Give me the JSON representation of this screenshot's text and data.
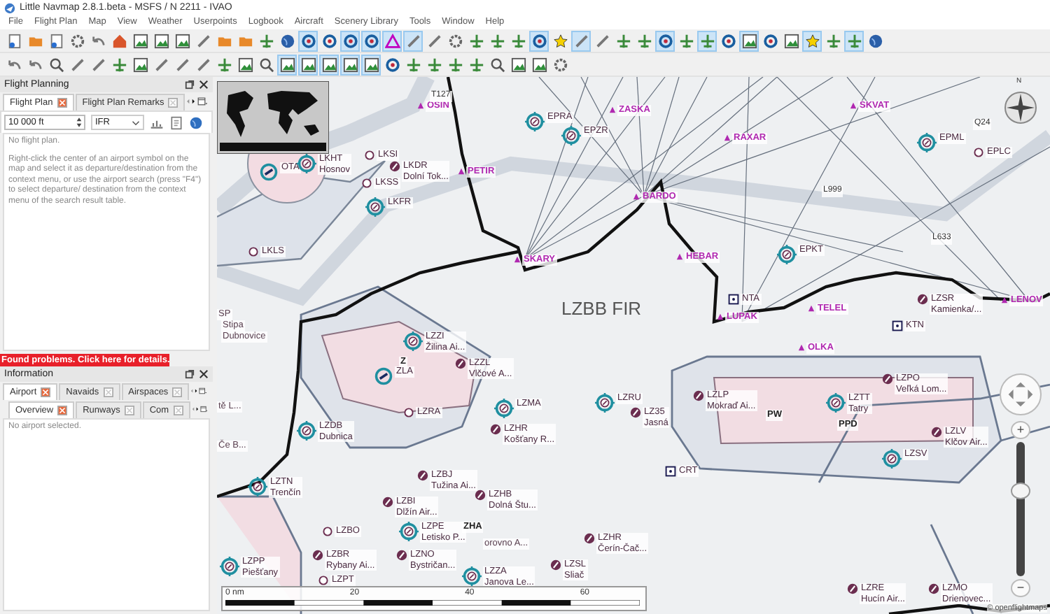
{
  "window": {
    "title": "Little Navmap 2.8.1.beta - MSFS / N 2211 - IVAO"
  },
  "menu": [
    "File",
    "Flight Plan",
    "Map",
    "View",
    "Weather",
    "Userpoints",
    "Logbook",
    "Aircraft",
    "Scenery Library",
    "Tools",
    "Window",
    "Help"
  ],
  "toolbar": {
    "rows": [
      [
        {
          "on": false
        },
        {
          "on": false
        },
        {
          "on": false
        },
        {
          "on": false
        },
        {
          "on": false
        },
        {
          "on": false
        },
        {
          "on": false
        },
        {
          "on": false
        },
        {
          "on": false
        },
        {
          "on": false
        },
        {
          "on": false
        },
        {
          "on": false
        },
        {
          "on": false
        },
        {
          "on": false
        },
        {
          "on": true
        },
        {
          "on": false
        },
        {
          "on": true
        },
        {
          "on": true
        },
        {
          "on": true
        },
        {
          "on": true
        },
        {
          "on": false
        },
        {
          "on": false
        },
        {
          "on": false
        },
        {
          "on": false
        },
        {
          "on": false
        },
        {
          "on": true
        },
        {
          "on": false
        },
        {
          "on": true
        },
        {
          "on": false
        },
        {
          "on": false
        },
        {
          "on": false
        },
        {
          "on": true
        },
        {
          "on": false
        },
        {
          "on": true
        },
        {
          "on": false
        },
        {
          "on": true
        },
        {
          "on": false
        },
        {
          "on": false
        },
        {
          "on": true
        },
        {
          "on": false
        },
        {
          "on": true
        },
        {
          "on": false
        }
      ],
      [
        {
          "on": false
        },
        {
          "on": false
        },
        {
          "on": false
        },
        {
          "on": false
        },
        {
          "on": false
        },
        {
          "on": false
        },
        {
          "on": false
        },
        {
          "on": false
        },
        {
          "on": false
        },
        {
          "on": false
        },
        {
          "on": false
        },
        {
          "on": false
        },
        {
          "on": false
        },
        {
          "on": true
        },
        {
          "on": true
        },
        {
          "on": true
        },
        {
          "on": true
        },
        {
          "on": true
        },
        {
          "on": false
        },
        {
          "on": false
        },
        {
          "on": false
        },
        {
          "on": false
        },
        {
          "on": false
        },
        {
          "on": false
        },
        {
          "on": false
        },
        {
          "on": false
        },
        {
          "on": false
        }
      ]
    ]
  },
  "flight_planning": {
    "title": "Flight Planning",
    "tabs": [
      {
        "label": "Flight Plan",
        "selected": true
      },
      {
        "label": "Flight Plan Remarks",
        "selected": false
      }
    ],
    "altitude": {
      "value": "10 000 ft"
    },
    "flight_rules": {
      "value": "IFR"
    },
    "status": "No flight plan.",
    "help": "Right-click the center of an airport symbol on the map and select it as departure/destination from the context menu, or use the airport search (press \"F4\") to select departure/ destination from the context menu of the search result table."
  },
  "problems_banner": "Found problems. Click here for details.",
  "information": {
    "title": "Information",
    "tabs_top": [
      {
        "label": "Airport",
        "selected": true
      },
      {
        "label": "Navaids",
        "selected": false
      },
      {
        "label": "Airspaces",
        "selected": false
      }
    ],
    "tabs_bottom": [
      {
        "label": "Overview",
        "selected": true
      },
      {
        "label": "Runways",
        "selected": false
      },
      {
        "label": "Com",
        "selected": false
      }
    ],
    "status": "No airport selected."
  },
  "map": {
    "labels": [
      {
        "kind": "vor",
        "label": "OTA"
      },
      {
        "kind": "tower",
        "label": "LKHT",
        "name": "Hosnov"
      },
      {
        "kind": "small",
        "label": "LKSI"
      },
      {
        "kind": "airport",
        "label": "LKDR",
        "name": "Dolní Tok..."
      },
      {
        "kind": "small",
        "label": "LKSS"
      },
      {
        "kind": "tower",
        "label": "LKFR"
      },
      {
        "kind": "small",
        "label": "LKLS"
      },
      {
        "kind": "waypoint",
        "label": "PETIR"
      },
      {
        "kind": "waypoint",
        "label": "OSIN"
      },
      {
        "kind": "tower",
        "label": "EPRA"
      },
      {
        "kind": "tower",
        "label": "EPZR"
      },
      {
        "kind": "waypoint",
        "label": "ZASKA"
      },
      {
        "kind": "waypoint",
        "label": "RAXAR"
      },
      {
        "kind": "waypoint",
        "label": "SKVAT"
      },
      {
        "kind": "tower",
        "label": "EPML"
      },
      {
        "kind": "small",
        "label": "EPLC"
      },
      {
        "kind": "waypoint",
        "label": "BARDO"
      },
      {
        "kind": "waypoint",
        "label": "SKARY"
      },
      {
        "kind": "waypoint",
        "label": "HEBAR"
      },
      {
        "kind": "tower",
        "label": "EPKT"
      },
      {
        "kind": "ndb",
        "label": "NTA"
      },
      {
        "kind": "waypoint",
        "label": "LUPAK"
      },
      {
        "kind": "region",
        "label": "LZBB FIR"
      },
      {
        "kind": "waypoint",
        "label": "TELEL"
      },
      {
        "kind": "airport",
        "label": "LZSR",
        "name": "Kamienka/..."
      },
      {
        "kind": "ndb",
        "label": "KTN"
      },
      {
        "kind": "waypoint",
        "label": "LENOV"
      },
      {
        "kind": "waypoint",
        "label": "OLKA"
      },
      {
        "kind": "tower",
        "label": "LZZI",
        "name": "Žilina Ai..."
      },
      {
        "kind": "marker",
        "label": "Z"
      },
      {
        "kind": "vor",
        "label": "ZLA"
      },
      {
        "kind": "airport",
        "label": "LZZL",
        "name": "Vlčové A..."
      },
      {
        "kind": "small",
        "label": "LZRA"
      },
      {
        "kind": "tower",
        "label": "LZMA"
      },
      {
        "kind": "tower",
        "label": "LZDB",
        "name": "Dubnica"
      },
      {
        "kind": "airport",
        "label": "LZHR",
        "name": "Košťany R..."
      },
      {
        "kind": "airport",
        "label": "LZBJ",
        "name": "Tužina Ai..."
      },
      {
        "kind": "tower",
        "label": "LZTN",
        "name": "Trenčín"
      },
      {
        "kind": "airport",
        "label": "LZHB",
        "name": "Dolná Štu..."
      },
      {
        "kind": "airport",
        "label": "LZBI",
        "name": "Dlžín Air..."
      },
      {
        "kind": "tower",
        "label": "LZPE",
        "name": "Letisko P..."
      },
      {
        "kind": "marker",
        "label": "ZHA"
      },
      {
        "kind": "text",
        "label": "orovno A..."
      },
      {
        "kind": "small",
        "label": "LZBO"
      },
      {
        "kind": "tower",
        "label": "LZPP",
        "name": "Piešťany"
      },
      {
        "kind": "airport",
        "label": "LZBR",
        "name": "Rybany Ai..."
      },
      {
        "kind": "airport",
        "label": "LZNO",
        "name": "Bystričan..."
      },
      {
        "kind": "tower",
        "label": "LZZA",
        "name": "Janova Le..."
      },
      {
        "kind": "airport",
        "label": "LZHR",
        "name": "Čerín-Čač..."
      },
      {
        "kind": "airport",
        "label": "LZSL",
        "name": "Sliač"
      },
      {
        "kind": "small",
        "label": "LZPT"
      },
      {
        "kind": "tower",
        "label": "LZRU"
      },
      {
        "kind": "airport",
        "label": "LZ35",
        "name": "Jasná"
      },
      {
        "kind": "airport",
        "label": "LZLP",
        "name": "Mokraď Ai..."
      },
      {
        "kind": "marker",
        "label": "PW"
      },
      {
        "kind": "tower",
        "label": "LZTT",
        "name": "Tatry"
      },
      {
        "kind": "airport",
        "label": "LZPO",
        "name": "Veľká Lom..."
      },
      {
        "kind": "marker",
        "label": "PPD"
      },
      {
        "kind": "airport",
        "label": "LZLV",
        "name": "Klčov Air..."
      },
      {
        "kind": "tower",
        "label": "LZSV"
      },
      {
        "kind": "ndb",
        "label": "CRT"
      },
      {
        "kind": "airport",
        "label": "LZRE",
        "name": "Hucín Air..."
      },
      {
        "kind": "airport",
        "label": "LZMO",
        "name": "Drienovec..."
      },
      {
        "kind": "text",
        "label": "SP"
      },
      {
        "kind": "text",
        "label": "Stipa"
      },
      {
        "kind": "text",
        "label": "Dubnovice"
      },
      {
        "kind": "text",
        "label": "tě L..."
      },
      {
        "kind": "text",
        "label": "Če B..."
      },
      {
        "kind": "airway",
        "label": "T127"
      },
      {
        "kind": "airway",
        "label": "L999"
      },
      {
        "kind": "airway",
        "label": "L633"
      },
      {
        "kind": "airway",
        "label": "Q24"
      }
    ],
    "scale": [
      "0 nm",
      "20",
      "40",
      "60"
    ],
    "compass": {
      "north": "N"
    },
    "zoom": {
      "in": "+",
      "out": "−",
      "level": 0.65
    },
    "attribution": "© openflightmaps"
  }
}
